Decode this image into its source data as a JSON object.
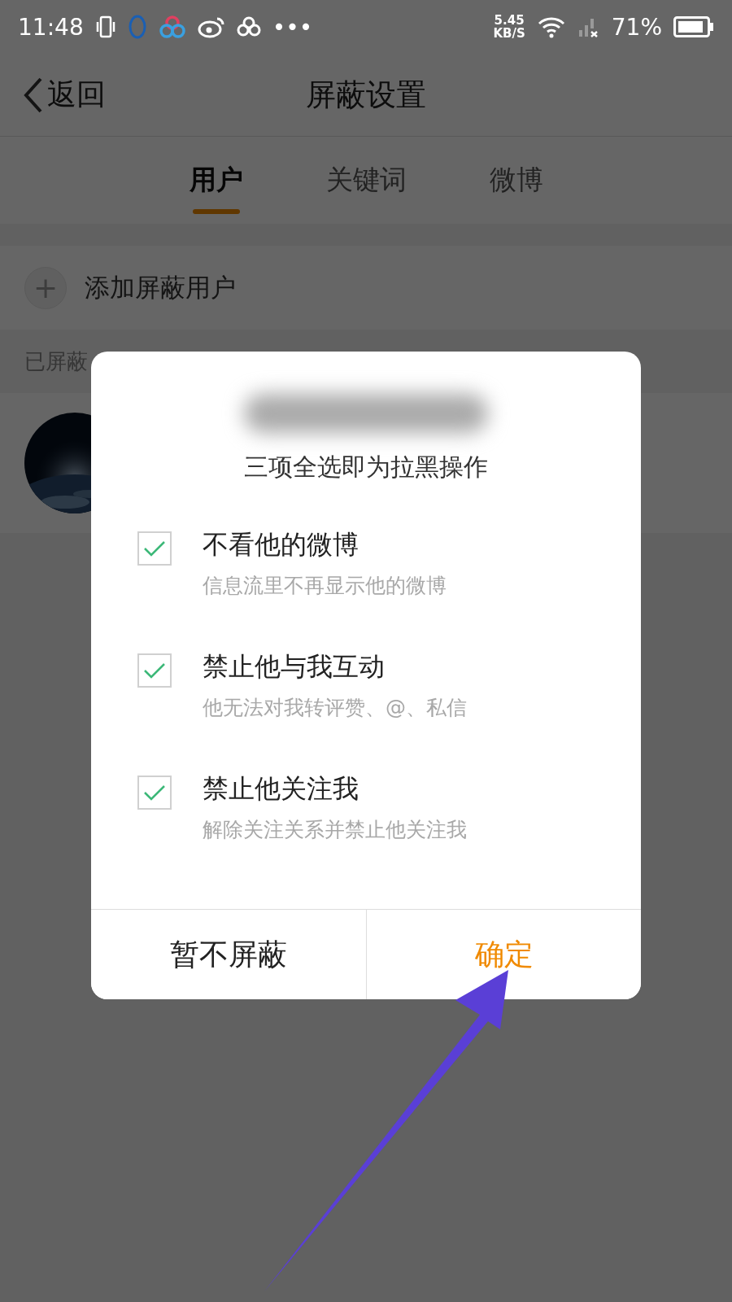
{
  "status_bar": {
    "time": "11:48",
    "more": "•••",
    "network_speed": "5.45",
    "speed_unit": "KB/S",
    "battery": "71%"
  },
  "header": {
    "back": "返回",
    "title": "屏蔽设置"
  },
  "tabs": [
    {
      "label": "用户",
      "selected": true
    },
    {
      "label": "关键词",
      "selected": false
    },
    {
      "label": "微博",
      "selected": false
    }
  ],
  "add_row": {
    "icon": "+",
    "label": "添加屏蔽用户"
  },
  "section_header": "已屏蔽",
  "dialog": {
    "subtitle": "三项全选即为拉黑操作",
    "options": [
      {
        "title": "不看他的微博",
        "description": "信息流里不再显示他的微博",
        "checked": true
      },
      {
        "title": "禁止他与我互动",
        "description": "他无法对我转评赞、@、私信",
        "checked": true
      },
      {
        "title": "禁止他关注我",
        "description": "解除关注关系并禁止他关注我",
        "checked": true
      }
    ],
    "buttons": [
      {
        "label": "暂不屏蔽",
        "kind": "cancel"
      },
      {
        "label": "确定",
        "kind": "confirm"
      }
    ]
  }
}
